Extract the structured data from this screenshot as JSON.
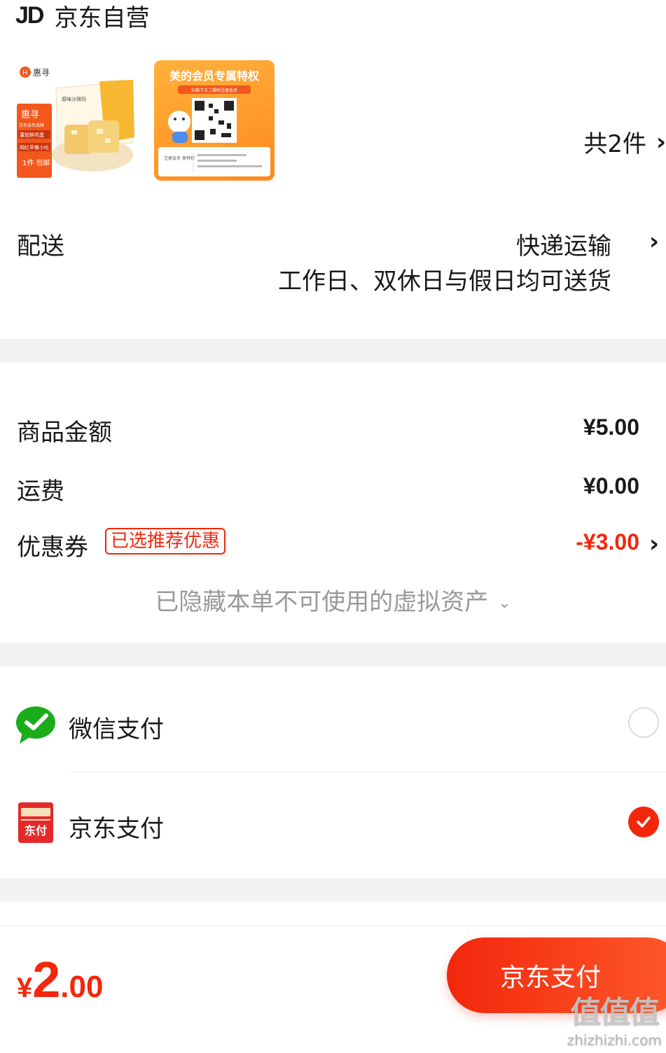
{
  "store": {
    "logo": "JD",
    "name": "京东自营"
  },
  "products": {
    "item_count": "共2件",
    "items": [
      {
        "brand": "惠寻",
        "tag_lines": [
          "惠寻",
          "京东自有品牌",
          "蓬软鲜鸡蛋",
          "网红早餐小吃",
          "1件 包邮"
        ],
        "box_text": "原味沙琪玛"
      },
      {
        "title": "美的会员专属特权",
        "sub": "扫描下方二维码注册会员",
        "foot_left": "注册会员 享特权"
      }
    ]
  },
  "delivery": {
    "label": "配送",
    "method": "快递运输",
    "note": "工作日、双休日与假日均可送货"
  },
  "summary": {
    "goods_label": "商品金额",
    "goods_value": "¥5.00",
    "shipping_label": "运费",
    "shipping_value": "¥0.00",
    "coupon_label": "优惠券",
    "coupon_tag": "已选推荐优惠",
    "coupon_value": "-¥3.00",
    "hidden_assets": "已隐藏本单不可使用的虚拟资产"
  },
  "payment": {
    "options": [
      {
        "label": "微信支付",
        "icon": "wechat-pay-icon",
        "selected": false
      },
      {
        "label": "京东支付",
        "icon": "jd-pay-icon",
        "icon_text": "东付",
        "selected": true
      }
    ]
  },
  "bottom": {
    "currency": "¥",
    "total_int": "2",
    "total_dec": ".00",
    "submit_label": "京东支付"
  },
  "watermark": {
    "main": "值值值",
    "sub": "zhizhizhi.com"
  },
  "colors": {
    "accent": "#f2270c",
    "wechat": "#1aad19",
    "band": "#f2f2f2",
    "muted": "#999999"
  }
}
